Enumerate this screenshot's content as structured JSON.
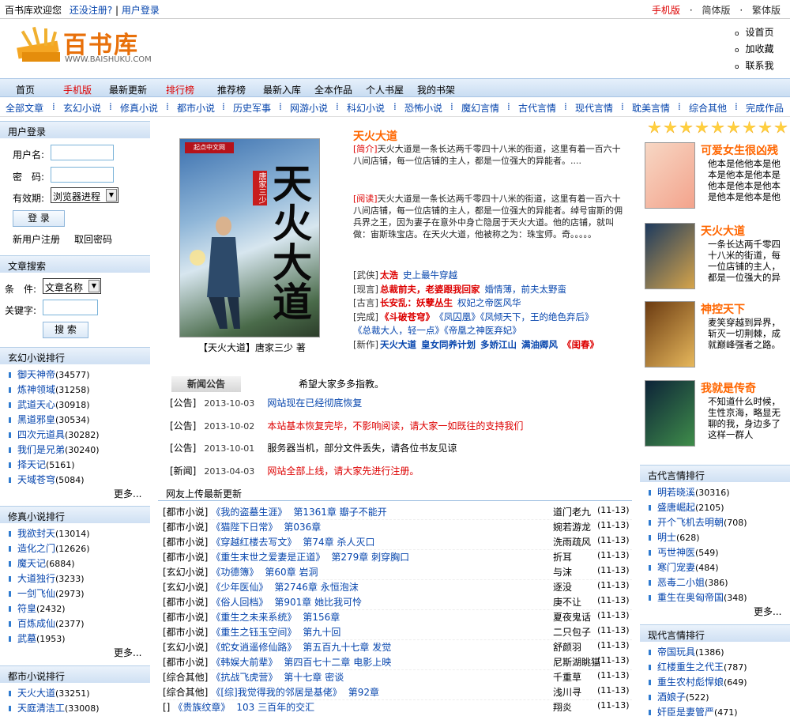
{
  "top": {
    "welcome": "百书库欢迎您",
    "reg": "还没注册?",
    "sep": "|",
    "login": "用户登录",
    "mobile": "手机版",
    "dot": "·",
    "simple": "简体版",
    "trad": "繁体版"
  },
  "logo": {
    "cn": "百书库",
    "url": "WWW.BAISHUKU.COM"
  },
  "rightlinks": [
    "设首页",
    "加收藏",
    "联系我"
  ],
  "nav": [
    {
      "label": "首页",
      "red": false
    },
    {
      "label": "手机版",
      "red": true
    },
    {
      "label": "最新更新",
      "red": false
    },
    {
      "label": "排行榜",
      "red": true
    },
    {
      "label": "推荐榜",
      "red": false
    },
    {
      "label": "最新入库",
      "red": false
    },
    {
      "label": "全本作品",
      "red": false
    },
    {
      "label": "个人书屋",
      "red": false
    },
    {
      "label": "我的书架",
      "red": false
    }
  ],
  "categories": [
    "全部文章",
    "玄幻小说",
    "修真小说",
    "都市小说",
    "历史军事",
    "网游小说",
    "科幻小说",
    "恐怖小说",
    "魔幻言情",
    "古代言情",
    "现代言情",
    "耽美言情",
    "综合其他",
    "完成作品"
  ],
  "login": {
    "title": "用户登录",
    "user_label": "用户名:",
    "pwd_label": "密　码:",
    "expire_label": "有效期:",
    "expire_value": "浏览器进程",
    "button": "登 录",
    "register": "新用户注册",
    "retrieve": "取回密码"
  },
  "search": {
    "title": "文章搜索",
    "cond_label": "条　件:",
    "cond_value": "文章名称",
    "key_label": "关键字:",
    "button": "搜 索"
  },
  "rank_xuanhuan": {
    "title": "玄幻小说排行",
    "items": [
      [
        "御天神帝",
        "(34577)"
      ],
      [
        "炼神领域",
        "(31258)"
      ],
      [
        "武道天心",
        "(30918)"
      ],
      [
        "黑道邪皇",
        "(30534)"
      ],
      [
        "四次元道具",
        "(30282)"
      ],
      [
        "我们是兄弟",
        "(30240)"
      ],
      [
        "择天记",
        "(5161)"
      ],
      [
        "天域苍穹",
        "(5084)"
      ]
    ],
    "more": "更多..."
  },
  "rank_xiuzhen": {
    "title": "修真小说排行",
    "items": [
      [
        "我欲封天",
        "(13014)"
      ],
      [
        "造化之门",
        "(12626)"
      ],
      [
        "魔天记",
        "(6884)"
      ],
      [
        "大道独行",
        "(3233)"
      ],
      [
        "一剑飞仙",
        "(2973)"
      ],
      [
        "符皇",
        "(2432)"
      ],
      [
        "百炼成仙",
        "(2377)"
      ],
      [
        "武墓",
        "(1953)"
      ]
    ],
    "more": "更多..."
  },
  "rank_dushi": {
    "title": "都市小说排行",
    "items": [
      [
        "天火大道",
        "(33251)"
      ],
      [
        "天庭清洁工",
        "(33008)"
      ]
    ]
  },
  "feature": {
    "title": "天火大道",
    "intro_tag": "[简介]",
    "intro": "天火大道是一条长达两千零四十八米的街道，这里有着一百六十八间店铺，每一位店铺的主人，都是一位强大的异能者。....",
    "read_tag": "[阅读]",
    "read": "天火大道是一条长达两千零四十八米的街道，这里有着一百六十八间店铺，每一位店铺的主人，都是一位强大的异能者。绰号宙斯的佣兵界之王，因为妻子在意外中身亡隐居于天火大道。他的店铺，就叫做：宙斯珠宝店。在天火大道，他被称之为：珠宝师。奇。。。。。",
    "caption": "【天火大道】唐家三少 著",
    "cover_text": "天火大道",
    "cover_author": "唐家三少",
    "cover_pub": "起点中文网"
  },
  "genre_rows": [
    {
      "tag": "[武侠]",
      "items": [
        {
          "t": "太浩",
          "c": "red"
        },
        {
          "t": "史上最牛穿越",
          "c": "blue"
        }
      ]
    },
    {
      "tag": "[现言]",
      "items": [
        {
          "t": "总裁前夫，老婆跟我回家",
          "c": "red"
        },
        {
          "t": "婚情薄，前夫太野蛮",
          "c": "blue"
        }
      ]
    },
    {
      "tag": "[古言]",
      "items": [
        {
          "t": "长安乱：妖孽丛生",
          "c": "red"
        },
        {
          "t": "权妃之帝医风华",
          "c": "blue"
        }
      ]
    },
    {
      "tag": "[完成]",
      "items": [
        {
          "t": "《斗破苍穹》",
          "c": "red"
        },
        {
          "t": "《凤囚凰》《凤倾天下，王的绝色弃后》",
          "c": "blue"
        }
      ]
    },
    {
      "tag": "",
      "items": [
        {
          "t": "《总裁大人，轻一点》《帝凰之神医弃妃》",
          "c": "blue"
        }
      ]
    },
    {
      "tag": "[新作]",
      "items": [
        {
          "t": "天火大道",
          "c": "blue"
        },
        {
          "t": "皇女同养计划",
          "c": "blue"
        },
        {
          "t": "多娇江山",
          "c": "blue"
        },
        {
          "t": "满油卿风",
          "c": "blue"
        },
        {
          "t": "《闺春》",
          "c": "red"
        }
      ]
    }
  ],
  "news": {
    "title": "新闻公告",
    "intro": "希望大家多多指教。",
    "rows": [
      {
        "tag": "[公告]",
        "date": "2013-10-03",
        "text": "网站现在已经彻底恢复",
        "c": "blue"
      },
      {
        "tag": "[公告]",
        "date": "2013-10-02",
        "text": "本站基本恢复完毕，不影响阅读，请大家一如既往的支持我们",
        "c": "red"
      },
      {
        "tag": "[公告]",
        "date": "2013-10-01",
        "text": "服务器当机，部分文件丢失，请各位书友见谅",
        "c": "black"
      },
      {
        "tag": "[新闻]",
        "date": "2013-04-03",
        "text": "网站全部上线，请大家先进行注册。",
        "c": "red"
      }
    ]
  },
  "updates": {
    "title": "网友上传最新更新",
    "rows": [
      [
        "[都市小说]",
        "《我的盗墓生涯》",
        "第1361章 瓣子不能开",
        "道门老九",
        "(11-13)"
      ],
      [
        "[都市小说]",
        "《猫陛下日常》",
        "第036章",
        "婉若游龙",
        "(11-13)"
      ],
      [
        "[都市小说]",
        "《穿越红楼去写文》",
        "第74章 杀人灭口",
        "洗雨疏风",
        "(11-13)"
      ],
      [
        "[都市小说]",
        "《重生末世之爱妻是正道》",
        "第279章 刺穿胸口",
        "折耳",
        "(11-13)"
      ],
      [
        "[玄幻小说]",
        "《功德簿》",
        "第60章 岩洞",
        "与沫",
        "(11-13)"
      ],
      [
        "[玄幻小说]",
        "《少年医仙》",
        "第2746章 永恒泡沫",
        "逐没",
        "(11-13)"
      ],
      [
        "[都市小说]",
        "《俗人回档》",
        "第901章 她比我可怜",
        "庚不让",
        "(11-13)"
      ],
      [
        "[都市小说]",
        "《重生之未来系统》",
        "第156章",
        "夏夜鬼话",
        "(11-13)"
      ],
      [
        "[都市小说]",
        "《重生之钰玉空间》",
        "第九十回",
        "二只包子",
        "(11-13)"
      ],
      [
        "[玄幻小说]",
        "《蛇女逍遥修仙路》",
        "第五百九十七章 发觉",
        "舒颜羽",
        "(11-13)"
      ],
      [
        "[都市小说]",
        "《韩娱大前辈》",
        "第四百七十二章 电影上映",
        "尼斯湖眺猫",
        "(11-13)"
      ],
      [
        "[综合其他]",
        "《抗战飞虎营》",
        "第十七章 密谈",
        "千重草",
        "(11-13)"
      ],
      [
        "[综合其他]",
        "《[综]我觉得我的邻居是基佬》",
        "第92章",
        "浅川寻",
        "(11-13)"
      ],
      [
        "[]",
        "《贵族纹章》",
        "103 三百年的交汇",
        "翔炎",
        "(11-13)"
      ]
    ]
  },
  "rec": [
    {
      "title": "可爱女生很凶残",
      "desc": "他本是他他本是他本是他本是他本是他本是他本是他本是他本是他本是他本是他本是他本是他本是他本是"
    },
    {
      "title": "天火大道",
      "desc": "一条长达两千零四十八米的街道，每一位店铺的主人，都是一位强大的异能者"
    },
    {
      "title": "神控天下",
      "desc": "麦笑穿越到异界，斩灭一切荆棘，成就巅峰强者之路。"
    },
    {
      "title": "我就是传奇",
      "desc": "不知道什么时候，生性京海，略显无聊的我，身边多了这样一群人"
    }
  ],
  "rank_gudai": {
    "title": "古代言情排行",
    "items": [
      [
        "明若晓溪",
        "(30316)"
      ],
      [
        "盛唐崛起",
        "(2105)"
      ],
      [
        "开个飞机去明朝",
        "(708)"
      ],
      [
        "明士",
        "(628)"
      ],
      [
        "丐世神医",
        "(549)"
      ],
      [
        "寒门宠妻",
        "(484)"
      ],
      [
        "恶毒二小姐",
        "(386)"
      ],
      [
        "重生在奥匈帝国",
        "(348)"
      ]
    ],
    "more": "更多..."
  },
  "rank_xiandai": {
    "title": "现代言情排行",
    "items": [
      [
        "帝国玩具",
        "(1386)"
      ],
      [
        "红楼重生之代王",
        "(787)"
      ],
      [
        "重生农村彪悍娘",
        "(649)"
      ],
      [
        "酒娘子",
        "(522)"
      ],
      [
        "奸臣是妻管严",
        "(471)"
      ]
    ]
  }
}
